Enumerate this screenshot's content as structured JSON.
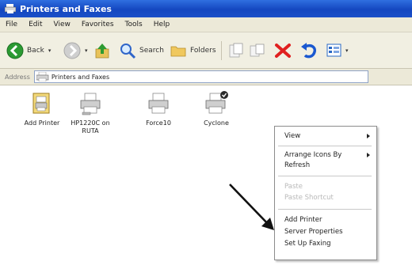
{
  "window": {
    "title": "Printers and Faxes"
  },
  "menubar": {
    "items": [
      "File",
      "Edit",
      "View",
      "Favorites",
      "Tools",
      "Help"
    ]
  },
  "toolbar": {
    "back_label": "Back",
    "search_label": "Search",
    "folders_label": "Folders"
  },
  "address": {
    "label": "Address",
    "value": "Printers and Faxes"
  },
  "printers": [
    {
      "label": "Add Printer",
      "icon": "add-printer-icon"
    },
    {
      "label": "HP1220C on RUTA",
      "icon": "printer-icon"
    },
    {
      "label": "Force10",
      "icon": "printer-icon"
    },
    {
      "label": "Cyclone",
      "icon": "printer-icon"
    }
  ],
  "context_menu": {
    "view": "View",
    "arrange": "Arrange Icons By",
    "refresh": "Refresh",
    "paste": "Paste",
    "paste_shortcut": "Paste Shortcut",
    "add_printer": "Add Printer",
    "server_properties": "Server Properties",
    "setup_faxing": "Set Up Faxing"
  },
  "colors": {
    "title_bar": "#1447c0",
    "back_button": "#2b9a33",
    "delete_x": "#e02020",
    "undo_blue": "#1a58d0"
  }
}
